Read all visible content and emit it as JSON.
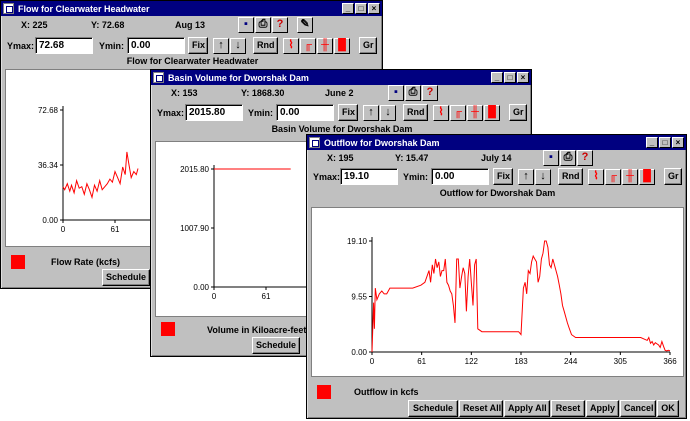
{
  "colors": {
    "series": "#ff0000",
    "titlebar": "#000080",
    "face": "#c0c0c0"
  },
  "icons": [
    "save-icon",
    "print-icon",
    "help-icon",
    "edit-icon",
    "line-chart-icon",
    "bar-chart-icon",
    "step-chart-icon",
    "filled-chart-icon"
  ],
  "w1": {
    "title": "Flow for Clearwater Headwater",
    "x_readout": "X: 225",
    "y_readout": "Y: 72.68",
    "date": "Aug 13",
    "ymax_label": "Ymax:",
    "ymax": "72.68",
    "ymin_label": "Ymin:",
    "ymin": "0.00",
    "fix": "Fix",
    "rnd": "Rnd",
    "gr": "Gr",
    "chart_title": "Flow for Clearwater Headwater",
    "legend": "Flow Rate (kcfs)",
    "schedule": "Schedule"
  },
  "w2": {
    "title": "Basin Volume for Dworshak Dam",
    "x_readout": "X: 153",
    "y_readout": "Y: 1868.30",
    "date": "June 2",
    "ymax_label": "Ymax:",
    "ymax": "2015.80",
    "ymin_label": "Ymin:",
    "ymin": "0.00",
    "fix": "Fix",
    "rnd": "Rnd",
    "gr": "Gr",
    "chart_title": "Basin Volume for Dworshak Dam",
    "legend": "Volume in Kiloacre-feet",
    "schedule": "Schedule"
  },
  "w3": {
    "title": "Outflow for Dworshak Dam",
    "x_readout": "X: 195",
    "y_readout": "Y: 15.47",
    "date": "July 14",
    "ymax_label": "Ymax:",
    "ymax": "19.10",
    "ymin_label": "Ymin:",
    "ymin": "0.00",
    "fix": "Fix",
    "rnd": "Rnd",
    "gr": "Gr",
    "chart_title": "Outflow for Dworshak Dam",
    "legend": "Outflow in kcfs",
    "buttons": {
      "schedule": "Schedule",
      "reset_all": "Reset All",
      "apply_all": "Apply All",
      "reset": "Reset",
      "apply": "Apply",
      "cancel": "Cancel",
      "ok": "OK"
    }
  },
  "chart_data": [
    {
      "type": "line",
      "title": "Flow for Clearwater Headwater",
      "series": [
        {
          "name": "Flow Rate (kcfs)",
          "color": "#ff0000",
          "x": [
            0,
            2,
            5,
            8,
            10,
            13,
            16,
            19,
            22,
            25,
            28,
            31,
            34,
            37,
            40,
            43,
            46,
            49,
            52,
            55,
            58,
            61,
            64,
            67,
            70,
            73,
            75,
            77,
            80,
            83,
            86,
            88
          ],
          "y": [
            22,
            20,
            24,
            19,
            23,
            18,
            26,
            21,
            22,
            17,
            24,
            20,
            15,
            23,
            19,
            26,
            20,
            22,
            24,
            27,
            25,
            32,
            28,
            24,
            35,
            30,
            45,
            38,
            28,
            32,
            30,
            34
          ]
        }
      ],
      "x_ticks": [
        "0",
        "61"
      ],
      "y_ticks": [
        "0.00",
        "36.34",
        "72.68"
      ],
      "ylim": [
        0,
        72.68
      ]
    },
    {
      "type": "line",
      "title": "Basin Volume for Dworshak Dam",
      "series": [
        {
          "name": "Volume in Kiloacre-feet",
          "color": "#ff0000",
          "x": [
            0,
            90
          ],
          "y": [
            2015.8,
            2015.8
          ]
        }
      ],
      "x_ticks": [
        "0",
        "61"
      ],
      "y_ticks": [
        "0.00",
        "1007.90",
        "2015.80"
      ],
      "ylim": [
        0,
        2015.8
      ]
    },
    {
      "type": "line",
      "title": "Outflow for Dworshak Dam",
      "series": [
        {
          "name": "Outflow in kcfs",
          "color": "#ff0000",
          "x": [
            0,
            2,
            3,
            4,
            6,
            9,
            12,
            15,
            18,
            22,
            30,
            40,
            50,
            60,
            65,
            70,
            72,
            74,
            76,
            78,
            80,
            82,
            84,
            86,
            88,
            90,
            92,
            94,
            96,
            98,
            100,
            102,
            104,
            106,
            108,
            110,
            112,
            114,
            116,
            118,
            120,
            122,
            124,
            126,
            128,
            130,
            135,
            140,
            150,
            160,
            170,
            175,
            180,
            183,
            186,
            188,
            190,
            192,
            194,
            196,
            198,
            200,
            202,
            204,
            206,
            208,
            210,
            212,
            214,
            216,
            218,
            220,
            222,
            224,
            226,
            228,
            230,
            232,
            234,
            236,
            238,
            240,
            242,
            245,
            250,
            255,
            260,
            280,
            305,
            320,
            330,
            338,
            340,
            342,
            344,
            346,
            348,
            350,
            352,
            354,
            356,
            358,
            360,
            362,
            364,
            366
          ],
          "y": [
            0,
            8.5,
            4,
            11,
            9,
            10,
            10.5,
            10,
            10,
            11,
            11,
            11,
            11,
            11.5,
            12,
            14,
            12,
            15,
            13.5,
            16,
            14.5,
            15.5,
            13,
            14,
            14,
            16,
            12,
            11.5,
            10.5,
            10,
            8,
            5,
            16,
            16,
            11,
            13,
            14.5,
            13.5,
            7,
            13,
            16,
            12,
            8,
            15,
            16,
            4,
            3.5,
            3.5,
            3.5,
            3.5,
            3.5,
            3.5,
            3.5,
            3,
            11,
            12,
            10,
            14,
            13.5,
            15.5,
            16.5,
            16,
            15.5,
            12,
            13,
            16,
            17,
            19.1,
            19.1,
            18,
            15,
            14.5,
            16,
            15,
            14,
            13,
            11.5,
            10,
            8,
            7,
            6,
            5,
            4.2,
            3,
            2.5,
            2.5,
            2.5,
            2.5,
            2.5,
            2.5,
            2.5,
            2,
            2.5,
            1.5,
            1.8,
            1.2,
            1.6,
            1.4,
            1.2,
            0.8,
            1.8,
            1,
            0.3,
            0.2,
            0.3,
            0.2
          ]
        }
      ],
      "x_ticks": [
        "0",
        "61",
        "122",
        "183",
        "244",
        "305",
        "366"
      ],
      "y_ticks": [
        "0.00",
        "9.55",
        "19.10"
      ],
      "ylim": [
        0,
        19.1
      ],
      "xlim": [
        0,
        366
      ]
    }
  ]
}
